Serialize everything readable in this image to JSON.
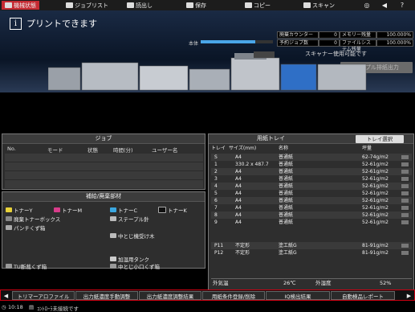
{
  "toolbar": {
    "items": [
      {
        "label": "機械状態"
      },
      {
        "label": "ジョブリスト"
      },
      {
        "label": "読出し"
      },
      {
        "label": "保存"
      },
      {
        "label": "コピー"
      },
      {
        "label": "スキャン"
      }
    ],
    "right_icons": [
      "globe-icon",
      "speaker-icon",
      "help-icon"
    ]
  },
  "header": {
    "message_icon": "i",
    "message": "プリントできます",
    "body_label": "本体",
    "body_progress": 0.75,
    "status": [
      {
        "label": "廃棄カウンター",
        "value": "0",
        "label2": "メモリー残量",
        "value2": "100.000%"
      },
      {
        "label": "予約ジョブ数",
        "value": "0",
        "label2": "ファイルシステム残量",
        "value2": "100.000%"
      }
    ],
    "scanner_text": "スキャナー使用可能です",
    "sample_button": "サンプル排紙出力"
  },
  "job_panel": {
    "title": "ジョブ",
    "columns": [
      "No.",
      "モード",
      "状態",
      "時間(分)",
      "ユーザー名"
    ]
  },
  "supply_panel": {
    "title": "補給/廃棄部材",
    "items": [
      {
        "label": "トナーY",
        "icon": "toner-y-icon"
      },
      {
        "label": "トナーM",
        "icon": "toner-m-icon"
      },
      {
        "label": "トナーC",
        "icon": "toner-c-icon"
      },
      {
        "label": "トナーK",
        "icon": "toner-k-icon"
      },
      {
        "label": "廃棄トナーボックス",
        "icon": "waste-toner-icon"
      },
      {
        "label": "ステープル針",
        "icon": "staple-icon"
      },
      {
        "label": "パンチくず箱",
        "icon": "punch-icon"
      },
      {
        "label": "中とじ機受け木",
        "icon": "saddle-icon"
      },
      {
        "label": "加湿用タンク",
        "icon": "tank-icon"
      },
      {
        "label": "TU断裁くず箱",
        "icon": "trim-box-icon"
      },
      {
        "label": "中とじ小口くず箱",
        "icon": "trim-box-2-icon"
      }
    ]
  },
  "tray_panel": {
    "title": "用紙トレイ",
    "select_button": "トレイ選択",
    "columns": [
      "トレイ",
      "サイズ(mm)",
      "名称",
      "坪量"
    ],
    "rows": [
      {
        "tray": "S",
        "size": "A4",
        "name": "普通紙",
        "weight": "62-74g/m2"
      },
      {
        "tray": "1",
        "size": "330.2 x 487.7",
        "name": "普通紙",
        "weight": "52-61g/m2"
      },
      {
        "tray": "2",
        "size": "A4",
        "name": "普通紙",
        "weight": "52-61g/m2"
      },
      {
        "tray": "3",
        "size": "A4",
        "name": "普通紙",
        "weight": "52-61g/m2"
      },
      {
        "tray": "4",
        "size": "A4",
        "name": "普通紙",
        "weight": "52-61g/m2"
      },
      {
        "tray": "5",
        "size": "A4",
        "name": "普通紙",
        "weight": "52-61g/m2"
      },
      {
        "tray": "6",
        "size": "A4",
        "name": "普通紙",
        "weight": "52-61g/m2"
      },
      {
        "tray": "7",
        "size": "A4",
        "name": "普通紙",
        "weight": "52-61g/m2"
      },
      {
        "tray": "8",
        "size": "A4",
        "name": "普通紙",
        "weight": "52-61g/m2"
      },
      {
        "tray": "9",
        "size": "A4",
        "name": "普通紙",
        "weight": "52-61g/m2"
      },
      {
        "tray": "P11",
        "size": "不定形",
        "name": "塗工紙G",
        "weight": "81-91g/m2"
      },
      {
        "tray": "P12",
        "size": "不定形",
        "name": "塗工紙G",
        "weight": "81-91g/m2"
      }
    ],
    "outside_temp_label": "外気温",
    "outside_temp": "26℃",
    "humidity_label": "外湿度",
    "humidity": "52%"
  },
  "tabs": [
    "トリマーアロファイル",
    "出力紙濃度手動調整",
    "出力紙濃度調整結果",
    "用紙条件登録/削除",
    "IQ検出結果",
    "自動検品レポート"
  ],
  "statusbar": {
    "time": "10:18",
    "message": "ｺﾝﾄﾛｰﾗ未接続です"
  }
}
